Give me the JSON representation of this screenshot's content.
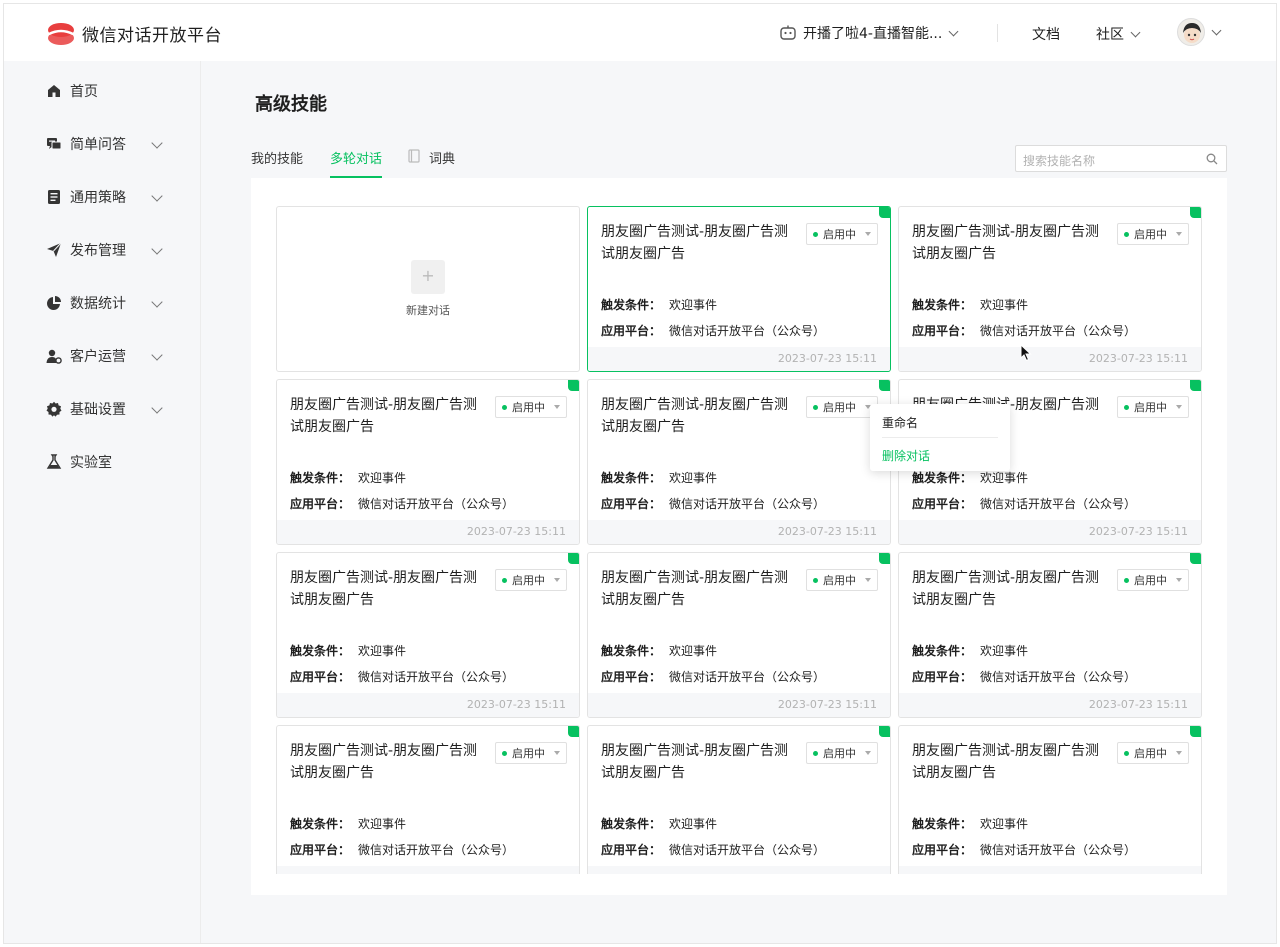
{
  "header": {
    "app_title": "微信对话开放平台",
    "bot_name": "开播了啦4-直播智能...",
    "docs_label": "文档",
    "community_label": "社区"
  },
  "sidebar": {
    "items": [
      {
        "label": "首页",
        "icon": "home-icon",
        "has_chevron": false
      },
      {
        "label": "简单问答",
        "icon": "chat-icon",
        "has_chevron": true
      },
      {
        "label": "通用策略",
        "icon": "document-icon",
        "has_chevron": true
      },
      {
        "label": "发布管理",
        "icon": "send-icon",
        "has_chevron": true
      },
      {
        "label": "数据统计",
        "icon": "pie-chart-icon",
        "has_chevron": true
      },
      {
        "label": "客户运营",
        "icon": "user-settings-icon",
        "has_chevron": true
      },
      {
        "label": "基础设置",
        "icon": "gear-icon",
        "has_chevron": true
      },
      {
        "label": "实验室",
        "icon": "flask-icon",
        "has_chevron": false
      }
    ]
  },
  "main": {
    "title": "高级技能",
    "tabs": [
      {
        "label": "我的技能",
        "active": false
      },
      {
        "label": "多轮对话",
        "active": true
      },
      {
        "label": "词典",
        "active": false
      }
    ],
    "search_placeholder": "搜索技能名称",
    "new_card_label": "新建对话",
    "new_card_plus": "+"
  },
  "card_labels": {
    "trigger": "触发条件：",
    "platform": "应用平台："
  },
  "cards": [
    {
      "title": "朋友圈广告测试-朋友圈广告测试朋友圈广告",
      "status": "启用中",
      "trigger": "欢迎事件",
      "platform": "微信对话开放平台（公众号）",
      "time": "2023-07-23 15:11",
      "selected": true
    },
    {
      "title": "朋友圈广告测试-朋友圈广告测试朋友圈广告",
      "status": "启用中",
      "trigger": "欢迎事件",
      "platform": "微信对话开放平台（公众号）",
      "time": "2023-07-23 15:11",
      "selected": false
    },
    {
      "title": "朋友圈广告测试-朋友圈广告测试朋友圈广告",
      "status": "启用中",
      "trigger": "欢迎事件",
      "platform": "微信对话开放平台（公众号）",
      "time": "2023-07-23 15:11",
      "selected": false
    },
    {
      "title": "朋友圈广告测试-朋友圈广告测试朋友圈广告",
      "status": "启用中",
      "trigger": "欢迎事件",
      "platform": "微信对话开放平台（公众号）",
      "time": "2023-07-23 15:11",
      "selected": false
    },
    {
      "title": "朋友圈广告测试-朋友圈广告测试朋友圈广告",
      "status": "启用中",
      "trigger": "欢迎事件",
      "platform": "微信对话开放平台（公众号）",
      "time": "2023-07-23 15:11",
      "selected": false
    },
    {
      "title": "朋友圈广告测试-朋友圈广告测试朋友圈广告",
      "status": "启用中",
      "trigger": "欢迎事件",
      "platform": "微信对话开放平台（公众号）",
      "time": "2023-07-23 15:11",
      "selected": false
    },
    {
      "title": "朋友圈广告测试-朋友圈广告测试朋友圈广告",
      "status": "启用中",
      "trigger": "欢迎事件",
      "platform": "微信对话开放平台（公众号）",
      "time": "2023-07-23 15:11",
      "selected": false
    },
    {
      "title": "朋友圈广告测试-朋友圈广告测试朋友圈广告",
      "status": "启用中",
      "trigger": "欢迎事件",
      "platform": "微信对话开放平台（公众号）",
      "time": "2023-07-23 15:11",
      "selected": false
    },
    {
      "title": "朋友圈广告测试-朋友圈广告测试朋友圈广告",
      "status": "启用中",
      "trigger": "欢迎事件",
      "platform": "微信对话开放平台（公众号）",
      "time": "",
      "selected": false
    },
    {
      "title": "朋友圈广告测试-朋友圈广告测试朋友圈广告",
      "status": "启用中",
      "trigger": "欢迎事件",
      "platform": "微信对话开放平台（公众号）",
      "time": "",
      "selected": false
    },
    {
      "title": "朋友圈广告测试-朋友圈广告测试朋友圈广告",
      "status": "启用中",
      "trigger": "欢迎事件",
      "platform": "微信对话开放平台（公众号）",
      "time": "",
      "selected": false
    }
  ],
  "context_menu": {
    "rename": "重命名",
    "delete": "删除对话"
  },
  "colors": {
    "accent": "#07c160",
    "brand_logo": "#e83e3e"
  }
}
